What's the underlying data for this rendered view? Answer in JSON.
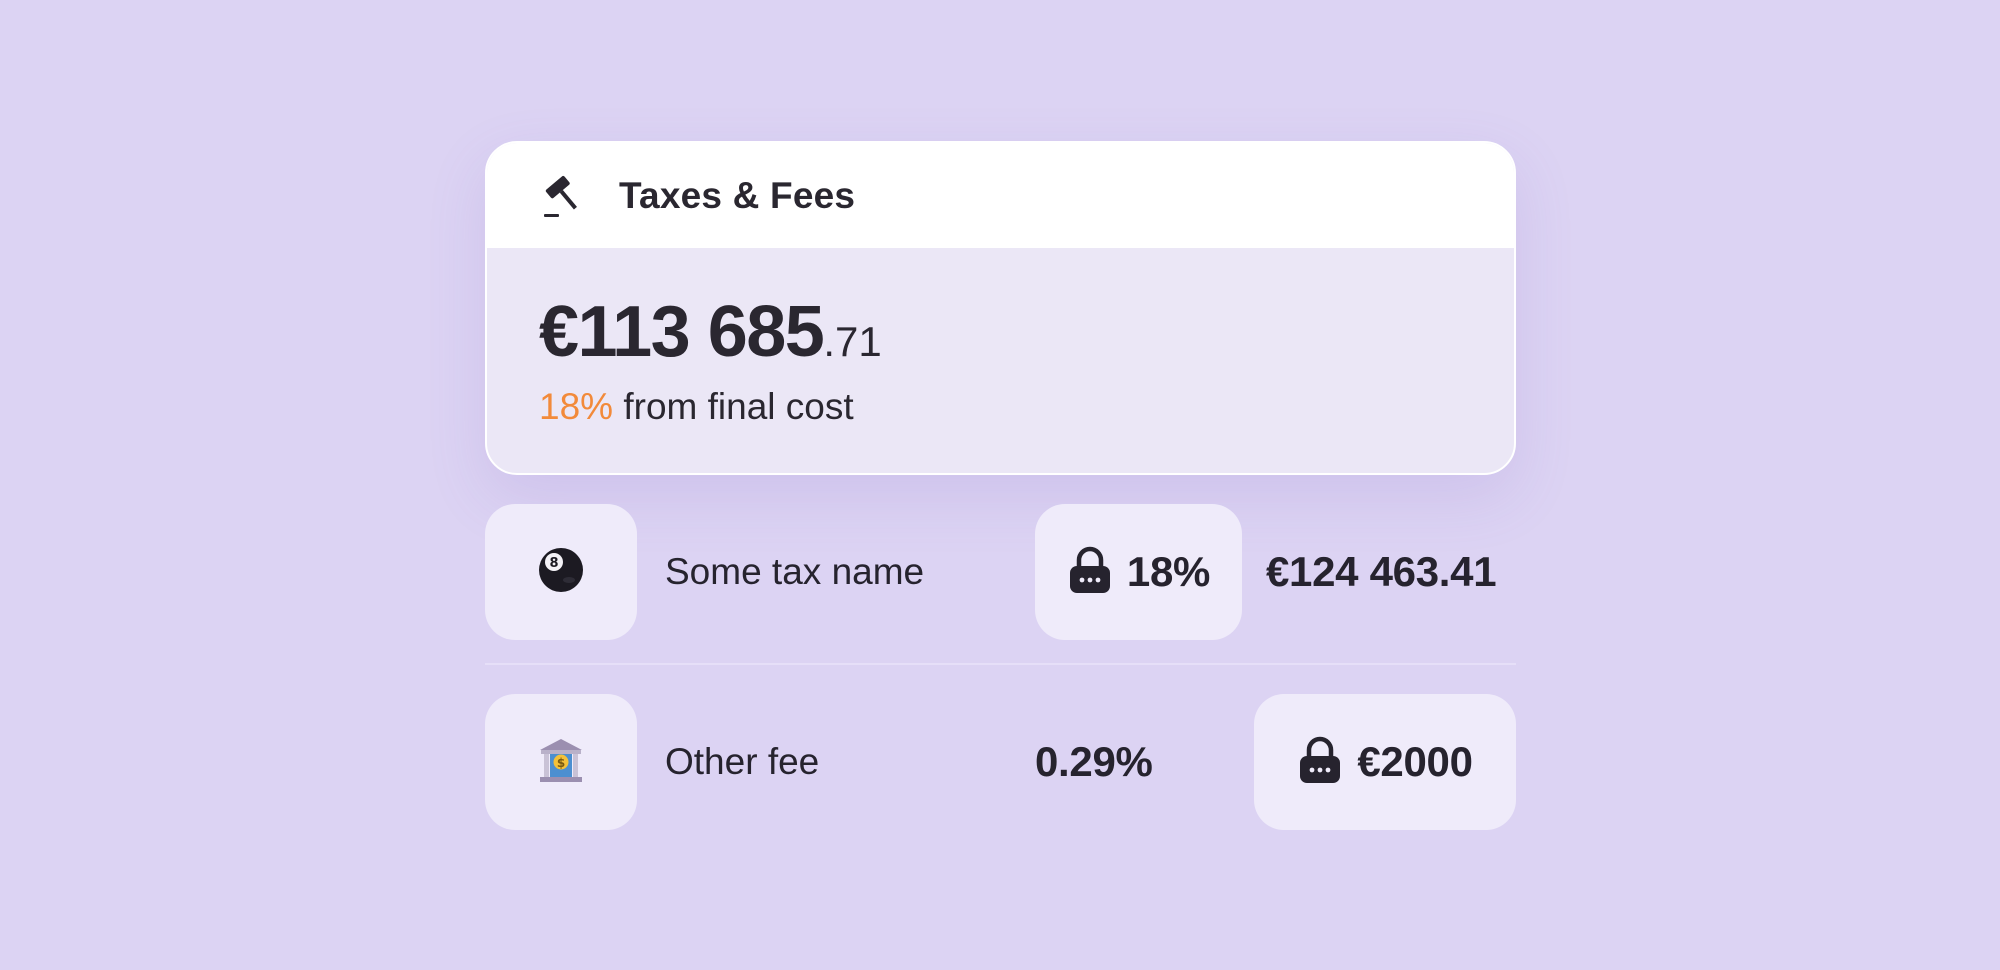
{
  "card": {
    "title": "Taxes & Fees",
    "icon": "gavel-icon",
    "amount_main": "€113 685",
    "amount_cents": ".71",
    "percent": "18%",
    "percent_suffix": "from final cost",
    "percent_color": "#f28a3a"
  },
  "rows": [
    {
      "icon": "eight-ball-icon",
      "name": "Some tax name",
      "rate": "18%",
      "rate_locked": true,
      "amount": "€124 463.41",
      "amount_locked": false
    },
    {
      "icon": "bank-icon",
      "name": "Other fee",
      "rate": "0.29%",
      "rate_locked": false,
      "amount": "€2000",
      "amount_locked": true
    }
  ],
  "colors": {
    "background": "#dcd3f3",
    "tile": "#efebfa",
    "accent": "#f28a3a"
  }
}
